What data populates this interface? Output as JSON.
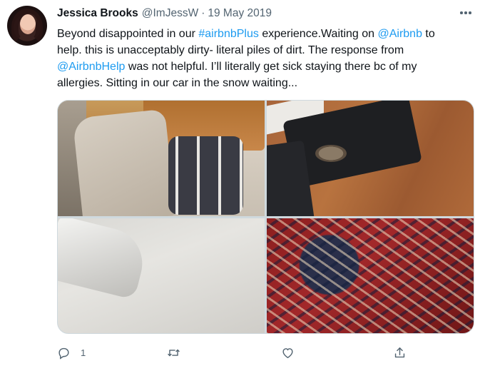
{
  "tweet": {
    "author_name": "Jessica Brooks",
    "handle": "@ImJessW",
    "separator": "·",
    "date": "19 May 2019",
    "text_lines": [
      [
        {
          "t": "Beyond disappointed in our ",
          "link": false
        },
        {
          "t": "#airbnbPlus",
          "link": true
        },
        {
          "t": " experience.Waiting on ",
          "link": false
        },
        {
          "t": "@Airbnb",
          "link": true
        },
        {
          "t": " to",
          "link": false
        }
      ],
      [
        {
          "t": "help. this is unacceptably dirty- literal piles of dirt. The response from",
          "link": false
        }
      ],
      [
        {
          "t": "@AirbnbHelp",
          "link": true
        },
        {
          "t": " was not helpful. I’ll literally get sick staying there bc of my",
          "link": false
        }
      ],
      [
        {
          "t": "allergies. Sitting in our car in the snow waiting...",
          "link": false
        }
      ]
    ],
    "reply_count": "1",
    "icons": {
      "more": "more-horizontal-icon",
      "reply": "reply-icon",
      "retweet": "retweet-icon",
      "like": "heart-icon",
      "share": "share-icon"
    },
    "colors": {
      "link": "#1d9bf0",
      "secondary_text": "#536471",
      "primary_text": "#0f1419"
    }
  }
}
